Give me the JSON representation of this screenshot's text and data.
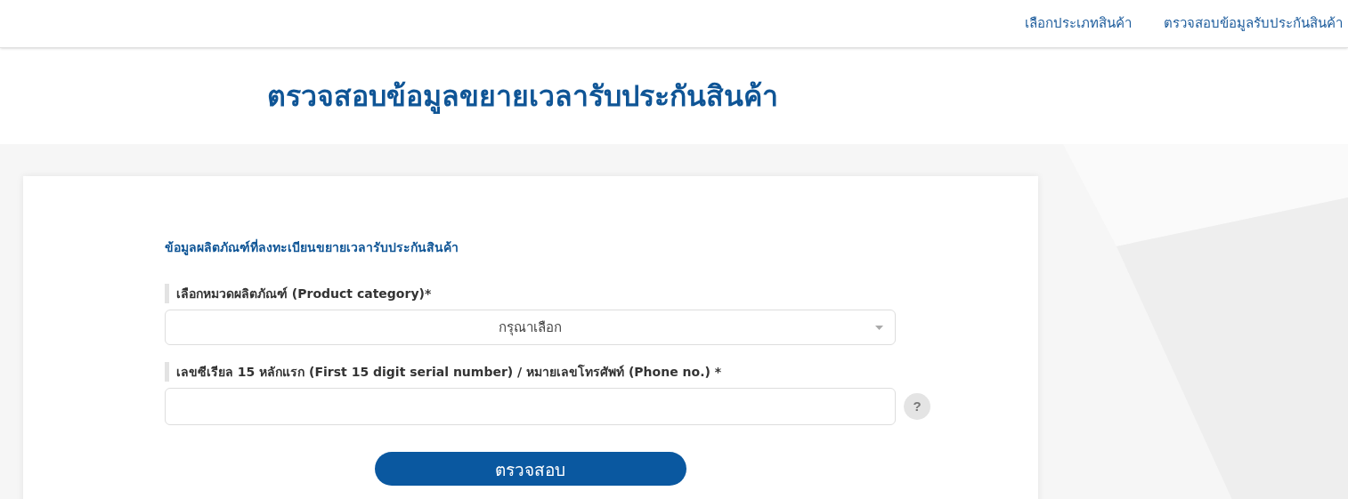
{
  "nav": {
    "links": [
      {
        "label": "เลือกประเภทสินค้า"
      },
      {
        "label": "ตรวจสอบข้อมูลรับประกันสินค้า"
      }
    ]
  },
  "page_title": "ตรวจสอบข้อมูลขยายเวลารับประกันสินค้า",
  "form": {
    "section_title": "ข้อมูลผลิตภัณฑ์ที่ลงทะเบียนขยายเวลารับประกันสินค้า",
    "fields": [
      {
        "kind": "select",
        "label": "เลือกหมวดผลิตภัณฑ์ (Product category)*",
        "value": "กรุณาเลือก"
      },
      {
        "kind": "text",
        "label": "เลขซีเรียล 15 หลักแรก (First 15 digit serial number) / หมายเลขโทรศัพท์ (Phone no.) *",
        "help": "?"
      }
    ],
    "submit": "ตรวจสอบ"
  }
}
